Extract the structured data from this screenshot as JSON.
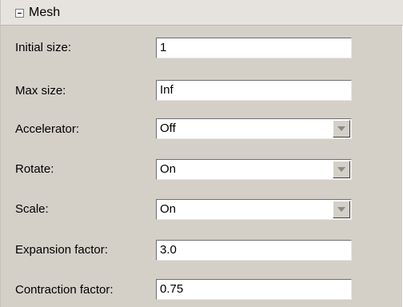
{
  "section": {
    "title": "Mesh",
    "icon": "collapse-minus-icon"
  },
  "fields": {
    "initial_size": {
      "label": "Initial size:",
      "value": "1"
    },
    "max_size": {
      "label": "Max size:",
      "value": "Inf"
    },
    "accelerator": {
      "label": "Accelerator:",
      "value": "Off"
    },
    "rotate": {
      "label": "Rotate:",
      "value": "On"
    },
    "scale": {
      "label": "Scale:",
      "value": "On"
    },
    "expansion_factor": {
      "label": "Expansion factor:",
      "value": "3.0"
    },
    "contraction_factor": {
      "label": "Contraction factor:",
      "value": "0.75"
    }
  },
  "colors": {
    "panel_background": "#d4d0c8",
    "header_background": "#e6e3de",
    "field_background": "#ffffff"
  }
}
